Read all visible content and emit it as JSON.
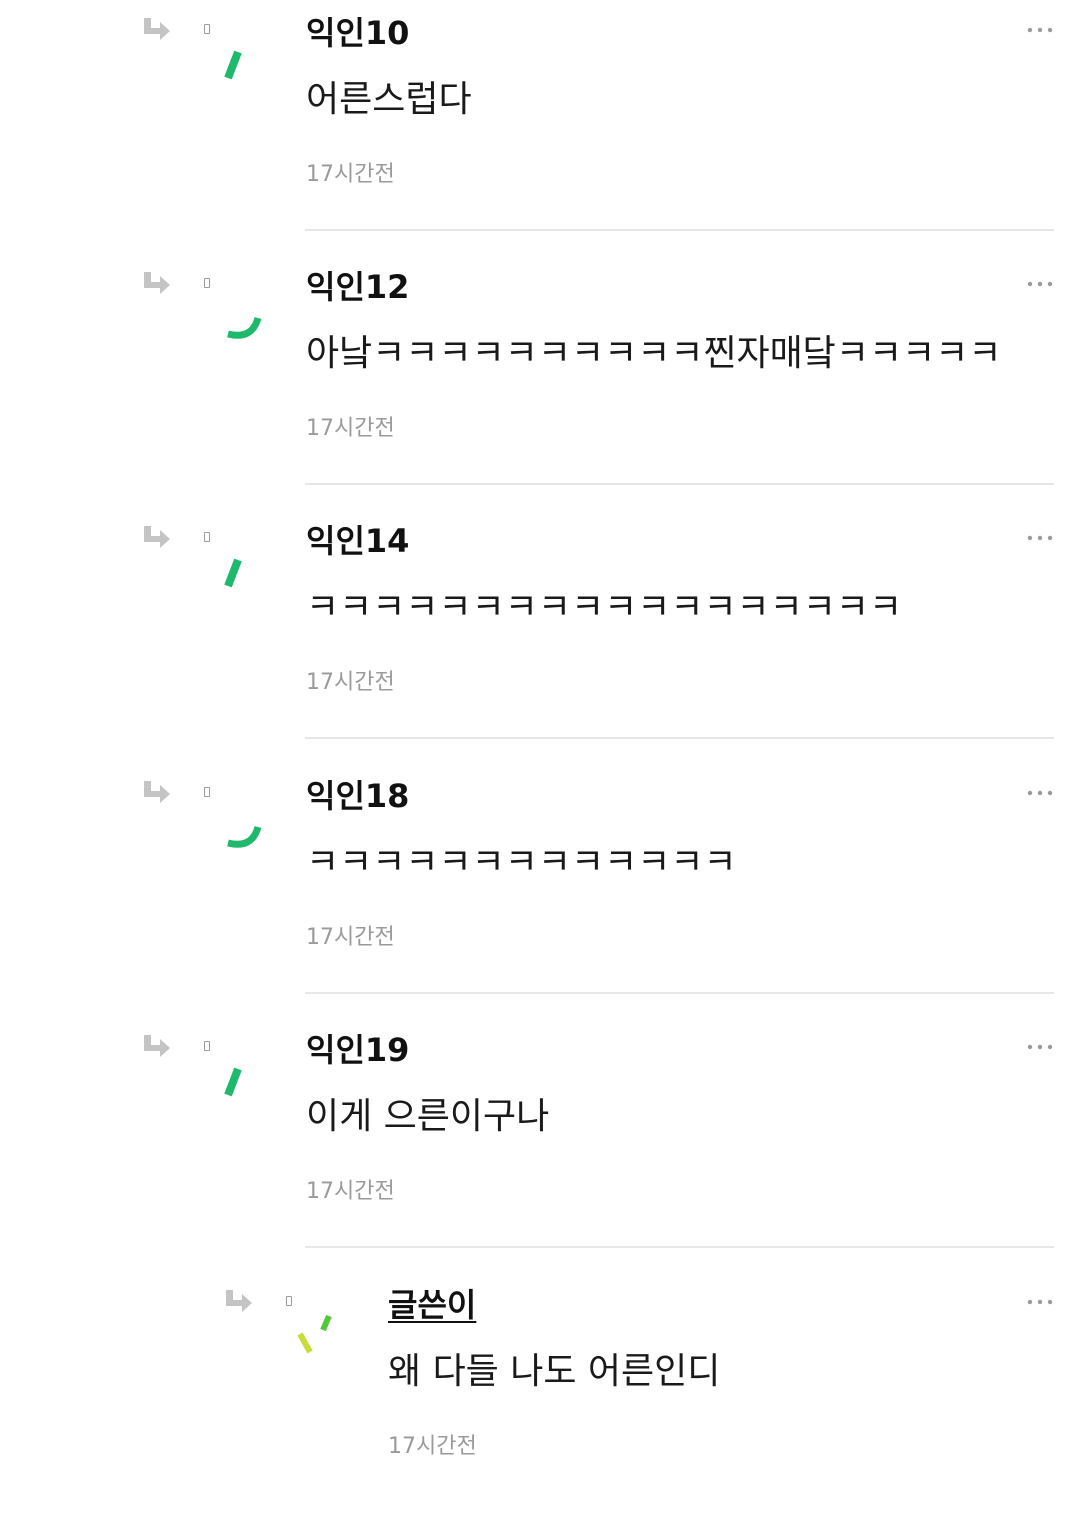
{
  "comments": [
    {
      "author": "익인10",
      "text": "어른스럽다",
      "time": "17시간전",
      "avatar_variant": "dash",
      "is_reply": false,
      "is_op": false
    },
    {
      "author": "익인12",
      "text": "아낰ㅋㅋㅋㅋㅋㅋㅋㅋㅋㅋ찐자매닼ㅋㅋㅋㅋㅋ",
      "time": "17시간전",
      "avatar_variant": "smile",
      "is_reply": false,
      "is_op": false
    },
    {
      "author": "익인14",
      "text": "ㅋㅋㅋㅋㅋㅋㅋㅋㅋㅋㅋㅋㅋㅋㅋㅋㅋㅋ",
      "time": "17시간전",
      "avatar_variant": "dash",
      "is_reply": false,
      "is_op": false
    },
    {
      "author": "익인18",
      "text": "ㅋㅋㅋㅋㅋㅋㅋㅋㅋㅋㅋㅋㅋ",
      "time": "17시간전",
      "avatar_variant": "smile",
      "is_reply": false,
      "is_op": false
    },
    {
      "author": "익인19",
      "text": "이게 으른이구나",
      "time": "17시간전",
      "avatar_variant": "dash",
      "is_reply": false,
      "is_op": false
    },
    {
      "author": "글쓴이",
      "text": "왜 다들 나도 어른인디",
      "time": "17시간전",
      "avatar_variant": "brows",
      "is_reply": true,
      "is_op": true
    }
  ],
  "icons": {
    "reply": "reply-arrow-icon",
    "marker": "dot-marker-icon",
    "more": "more-options-icon"
  },
  "colors": {
    "avatar_green": "#1fb96e",
    "avatar_yellow": "#c8dc3c",
    "avatar_lime": "#53c83a",
    "arrow_gray": "#c4c4c4",
    "timestamp_gray": "#9a9a9a",
    "divider": "#e6e6e6"
  }
}
